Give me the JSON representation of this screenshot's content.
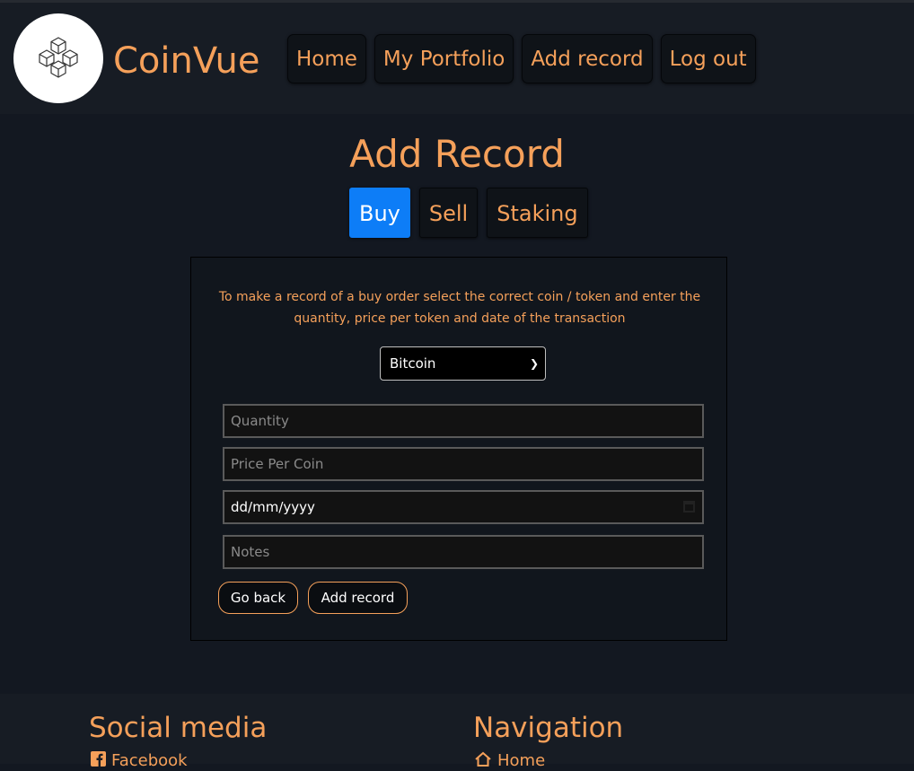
{
  "brand": {
    "name": "CoinVue",
    "logo_icon": "blocks-cube-icon"
  },
  "nav": {
    "items": [
      {
        "label": "Home"
      },
      {
        "label": "My Portfolio"
      },
      {
        "label": "Add record"
      },
      {
        "label": "Log out"
      }
    ]
  },
  "page": {
    "title": "Add Record"
  },
  "tabs": [
    {
      "label": "Buy",
      "active": true
    },
    {
      "label": "Sell",
      "active": false
    },
    {
      "label": "Staking",
      "active": false
    }
  ],
  "form": {
    "instructions": "To make a record of a buy order select the correct coin / token and enter the quantity, price per token and date of the transaction",
    "coin_select": {
      "selected": "Bitcoin"
    },
    "quantity_placeholder": "Quantity",
    "price_placeholder": "Price Per Coin",
    "date_placeholder": "dd/mm/yyyy",
    "notes_placeholder": "Notes",
    "go_back_label": "Go back",
    "add_record_label": "Add record"
  },
  "footer": {
    "social_heading": "Social media",
    "nav_heading": "Navigation",
    "social_link": "Facebook",
    "nav_link": "Home"
  },
  "colors": {
    "accent": "#f5a05a",
    "active_tab": "#0d7df7",
    "background": "#131821"
  }
}
